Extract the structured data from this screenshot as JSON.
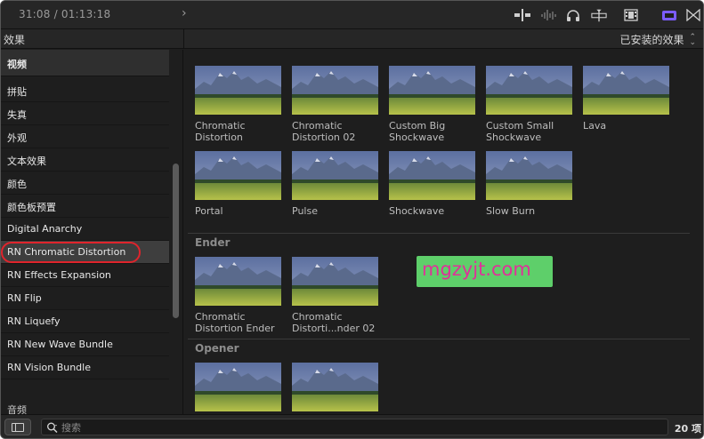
{
  "toolbar": {
    "timecode": "31:08 / 01:13:18",
    "icons": [
      "chevron-right-icon",
      "clip-trim-icon",
      "audio-waveform-icon",
      "headphones-icon",
      "snapping-icon",
      "filmstrip-icon",
      "effects-browser-icon",
      "transitions-browser-icon"
    ],
    "accent": "#7b5cff"
  },
  "sidebar": {
    "title": "效果",
    "category": "视频",
    "items": [
      {
        "label": "拼贴"
      },
      {
        "label": "失真"
      },
      {
        "label": "外观"
      },
      {
        "label": "文本效果"
      },
      {
        "label": "颜色"
      },
      {
        "label": "颜色板预置"
      },
      {
        "label": "Digital Anarchy"
      },
      {
        "label": "RN Chromatic Distortion"
      },
      {
        "label": "RN Effects Expansion"
      },
      {
        "label": "RN Flip"
      },
      {
        "label": "RN Liquefy"
      },
      {
        "label": "RN New Wave Bundle"
      },
      {
        "label": "RN Vision Bundle"
      }
    ],
    "selected": "RN Chromatic Distortion",
    "audio_label": "音频"
  },
  "content": {
    "filter_label": "已安装的效果",
    "effects": [
      {
        "label": "Chromatic\nDistortion"
      },
      {
        "label": "Chromatic\nDistortion 02"
      },
      {
        "label": "Custom Big\nShockwave"
      },
      {
        "label": "Custom Small\nShockwave"
      },
      {
        "label": "Lava"
      },
      {
        "label": "Portal"
      },
      {
        "label": "Pulse"
      },
      {
        "label": "Shockwave"
      },
      {
        "label": "Slow Burn"
      }
    ],
    "sections": [
      {
        "title": "Ender",
        "effects": [
          {
            "label": "Chromatic\nDistortion Ender"
          },
          {
            "label": "Chromatic\nDistorti...nder 02"
          }
        ]
      },
      {
        "title": "Opener",
        "effects": [
          {
            "label": ""
          },
          {
            "label": ""
          }
        ]
      }
    ]
  },
  "search": {
    "placeholder": "搜索",
    "value": ""
  },
  "footer": {
    "count": "20 项"
  },
  "watermark": "mgzyjt.com"
}
